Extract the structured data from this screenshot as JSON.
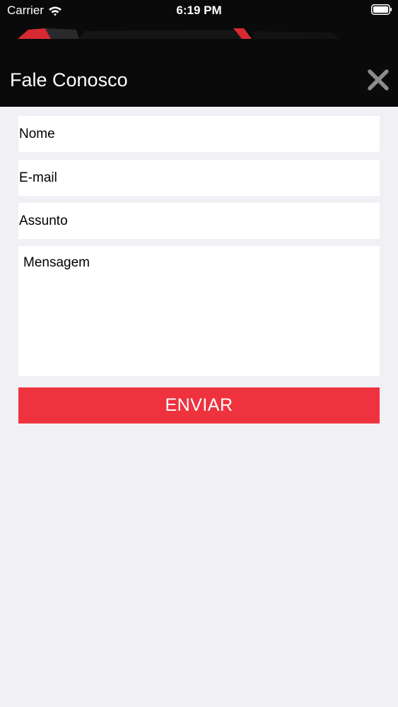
{
  "status_bar": {
    "carrier": "Carrier",
    "time": "6:19 PM"
  },
  "header": {
    "title": "Fale Conosco",
    "close_icon": "close-icon"
  },
  "form": {
    "name_placeholder": "Nome",
    "email_placeholder": "E-mail",
    "subject_placeholder": "Assunto",
    "message_placeholder": "Mensagem",
    "send_label": "ENVIAR"
  },
  "colors": {
    "header_bg": "#0a0a0b",
    "page_bg": "#f1f0f5",
    "accent": "#ee333e"
  }
}
